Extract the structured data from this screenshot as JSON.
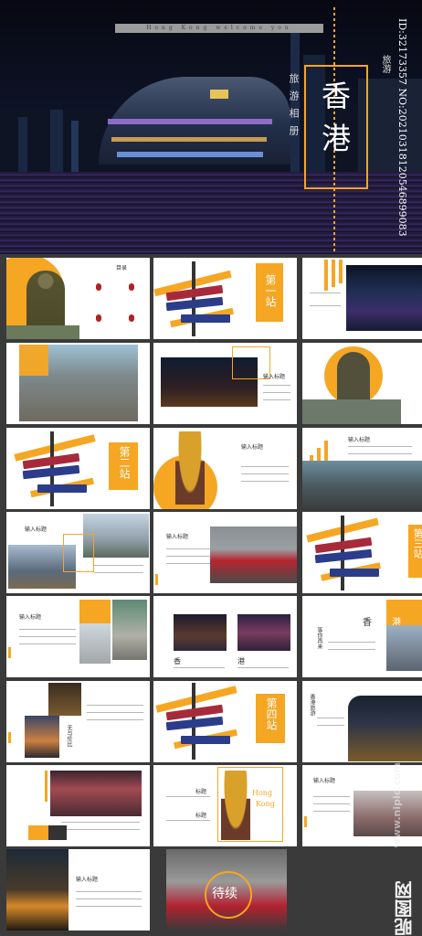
{
  "cover": {
    "tagline": "Hong Kong welcome you",
    "title": "香 港",
    "sub_small": "旅游",
    "sub_vertical": "旅游相册",
    "id_text": "ID:32173357 NO:20210318120546899083"
  },
  "slides": {
    "toc": {
      "title": "目录"
    },
    "station1": {
      "label": "第一站"
    },
    "station2": {
      "label": "第二站"
    },
    "station3": {
      "label": "第三站"
    },
    "station4": {
      "label": "第四站"
    },
    "input_title": "输入标题",
    "hk_vertical": "香港",
    "xiang": "香",
    "gang": "港",
    "dengnizailai": "等你再来",
    "wudaodi": "无与伦比",
    "biaoti": "标题",
    "kong": "Kong",
    "tbc": "待续",
    "hong": "Hong",
    "zhuang": "香港旅游"
  },
  "watermark": {
    "brand": "昵图网",
    "url": "www.nipic.com"
  },
  "colors": {
    "accent": "#f5a623",
    "background": "#3a3a3a"
  }
}
